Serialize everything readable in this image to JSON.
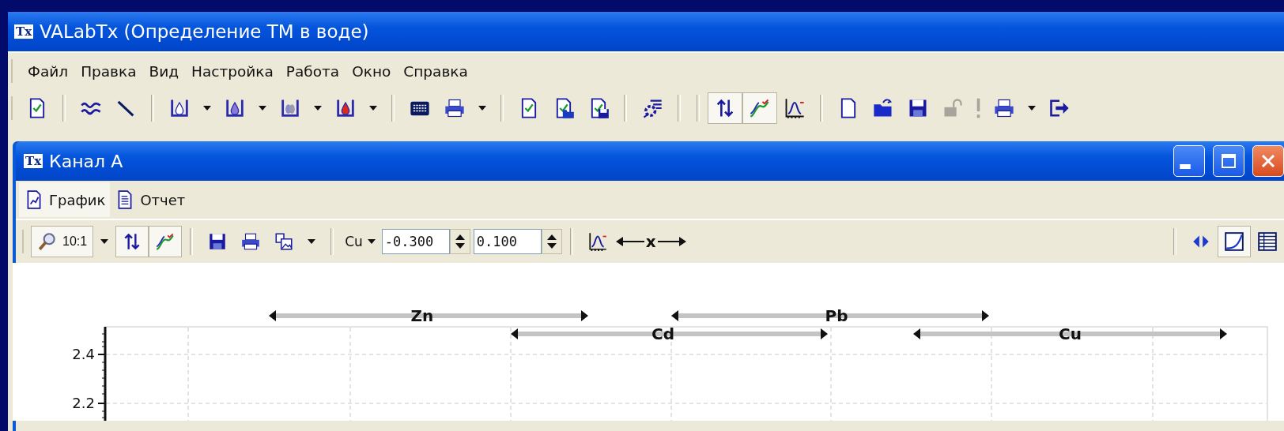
{
  "app_window": {
    "logo": "Tx",
    "title": "VALabTx (Определение ТМ в воде)"
  },
  "menu": [
    "Файл",
    "Правка",
    "Вид",
    "Настройка",
    "Работа",
    "Окно",
    "Справка"
  ],
  "main_toolbar": [
    [
      {
        "pressed": false,
        "disabled": false,
        "dropdown": false
      }
    ],
    [
      {
        "pressed": false,
        "disabled": false,
        "dropdown": false
      },
      {
        "pressed": false,
        "disabled": false,
        "dropdown": false
      }
    ],
    [
      {
        "pressed": false,
        "disabled": false,
        "dropdown": true
      },
      {
        "pressed": false,
        "disabled": false,
        "dropdown": true
      },
      {
        "pressed": false,
        "disabled": false,
        "dropdown": true
      },
      {
        "pressed": false,
        "disabled": false,
        "dropdown": true
      }
    ],
    [
      {
        "pressed": false,
        "disabled": false,
        "dropdown": false
      },
      {
        "pressed": false,
        "disabled": false,
        "dropdown": true
      }
    ],
    [
      {
        "pressed": false,
        "disabled": false,
        "dropdown": false
      },
      {
        "pressed": false,
        "disabled": false,
        "dropdown": false
      },
      {
        "pressed": false,
        "disabled": false,
        "dropdown": false
      }
    ],
    [
      {
        "pressed": false,
        "disabled": false,
        "dropdown": false
      }
    ],
    [
      {
        "pressed": true,
        "disabled": false,
        "dropdown": false
      },
      {
        "pressed": true,
        "disabled": false,
        "dropdown": false
      },
      {
        "pressed": false,
        "disabled": false,
        "dropdown": false
      }
    ],
    [
      {
        "pressed": false,
        "disabled": false,
        "dropdown": false
      },
      {
        "pressed": false,
        "disabled": false,
        "dropdown": false
      },
      {
        "pressed": false,
        "disabled": false,
        "dropdown": false
      },
      {
        "pressed": false,
        "disabled": true,
        "dropdown": false
      },
      {
        "pressed": false,
        "disabled": true,
        "dropdown": false
      },
      {
        "pressed": false,
        "disabled": false,
        "dropdown": true
      },
      {
        "pressed": false,
        "disabled": false,
        "dropdown": false
      }
    ]
  ],
  "document_window": {
    "logo": "Tx",
    "title": "Канал А"
  },
  "tabs": [
    {
      "label": "График",
      "selected": true
    },
    {
      "label": "Отчет",
      "selected": false
    }
  ],
  "chart_toolbar": {
    "zoom": {
      "label": "10:1",
      "pressed": true
    },
    "view_buttons": [
      {
        "pressed": true
      },
      {
        "pressed": true
      }
    ],
    "output_buttons": [
      {
        "pressed": false
      },
      {
        "pressed": false
      },
      {
        "pressed": false
      }
    ],
    "element_select": {
      "value": "Cu"
    },
    "range_fields": [
      {
        "value": "-0.300"
      },
      {
        "value": "0.100"
      }
    ],
    "axis_label": "x",
    "display_buttons": [
      {
        "pressed": false
      },
      {
        "pressed": true
      },
      {
        "pressed": false
      }
    ]
  },
  "chart": {
    "y_tick_labels": [
      "2.4",
      "2.2"
    ],
    "element_ranges": [
      {
        "element": "Zn"
      },
      {
        "element": "Cd"
      },
      {
        "element": "Pb"
      },
      {
        "element": "Cu"
      }
    ]
  }
}
